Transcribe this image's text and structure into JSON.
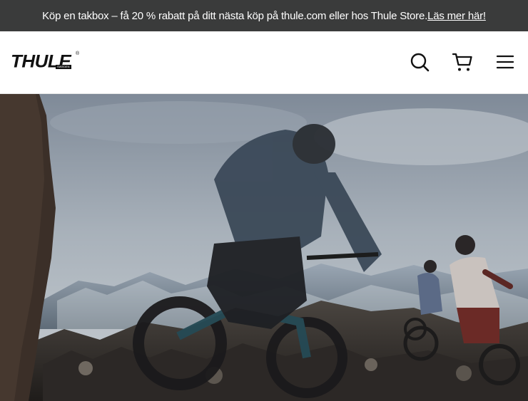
{
  "promo": {
    "text": "Köp en takbox – få 20 % rabatt på ditt nästa köp på thule.com eller hos Thule Store.",
    "link_label": " Läs mer här!"
  },
  "header": {
    "logo_text": "THULE",
    "logo_sub": "SWEDEN",
    "logo_reg": "®",
    "icons": [
      "search-icon",
      "cart-icon",
      "menu-icon"
    ]
  },
  "hero": {
    "description_icon": "mountain-biking-video"
  },
  "colors": {
    "promo_bg": "#3a3b3b",
    "promo_text": "#ffffff",
    "header_bg": "#ffffff",
    "icon": "#111111"
  }
}
